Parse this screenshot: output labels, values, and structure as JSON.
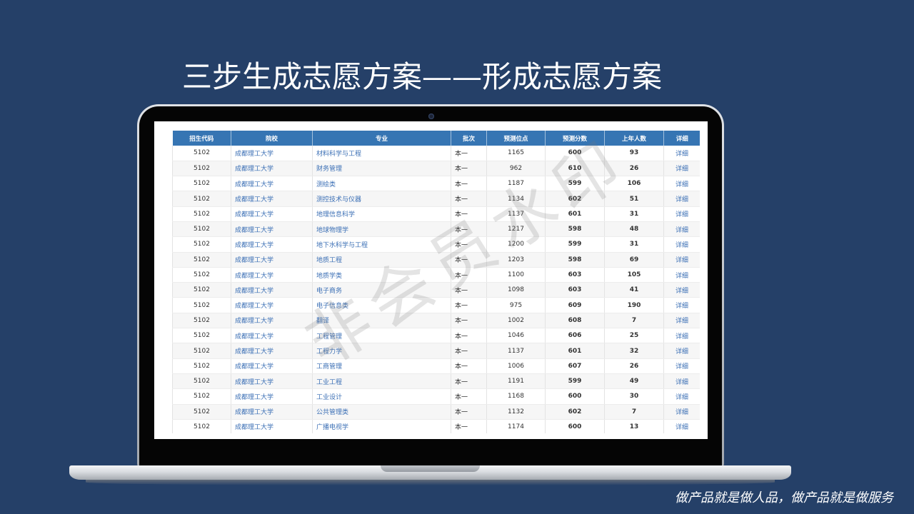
{
  "slide": {
    "title": "三步生成志愿方案——形成志愿方案",
    "footer_slogan": "做产品就是做人品，做产品就是做服务",
    "watermark": "非会员水印"
  },
  "colors": {
    "background": "#254068",
    "table_header": "#3675b3",
    "link": "#3b6fb5"
  },
  "table": {
    "headers": [
      "招生代码",
      "院校",
      "专业",
      "批次",
      "预测位点",
      "预测分数",
      "上年人数",
      "详细"
    ],
    "rows": [
      {
        "code": "5102",
        "school": "成都理工大学",
        "major": "材料科学与工程",
        "batch": "本一",
        "predicted_rank": 1165,
        "predicted_score": 600,
        "last_year_count": 93,
        "detail": "详细"
      },
      {
        "code": "5102",
        "school": "成都理工大学",
        "major": "财务管理",
        "batch": "本一",
        "predicted_rank": 962,
        "predicted_score": 610,
        "last_year_count": 26,
        "detail": "详细"
      },
      {
        "code": "5102",
        "school": "成都理工大学",
        "major": "测绘类",
        "batch": "本一",
        "predicted_rank": 1187,
        "predicted_score": 599,
        "last_year_count": 106,
        "detail": "详细"
      },
      {
        "code": "5102",
        "school": "成都理工大学",
        "major": "测控技术与仪器",
        "batch": "本一",
        "predicted_rank": 1134,
        "predicted_score": 602,
        "last_year_count": 51,
        "detail": "详细"
      },
      {
        "code": "5102",
        "school": "成都理工大学",
        "major": "地理信息科学",
        "batch": "本一",
        "predicted_rank": 1137,
        "predicted_score": 601,
        "last_year_count": 31,
        "detail": "详细"
      },
      {
        "code": "5102",
        "school": "成都理工大学",
        "major": "地球物理学",
        "batch": "本一",
        "predicted_rank": 1217,
        "predicted_score": 598,
        "last_year_count": 48,
        "detail": "详细"
      },
      {
        "code": "5102",
        "school": "成都理工大学",
        "major": "地下水科学与工程",
        "batch": "本一",
        "predicted_rank": 1200,
        "predicted_score": 599,
        "last_year_count": 31,
        "detail": "详细"
      },
      {
        "code": "5102",
        "school": "成都理工大学",
        "major": "地质工程",
        "batch": "本一",
        "predicted_rank": 1203,
        "predicted_score": 598,
        "last_year_count": 69,
        "detail": "详细"
      },
      {
        "code": "5102",
        "school": "成都理工大学",
        "major": "地质学类",
        "batch": "本一",
        "predicted_rank": 1100,
        "predicted_score": 603,
        "last_year_count": 105,
        "detail": "详细"
      },
      {
        "code": "5102",
        "school": "成都理工大学",
        "major": "电子商务",
        "batch": "本一",
        "predicted_rank": 1098,
        "predicted_score": 603,
        "last_year_count": 41,
        "detail": "详细"
      },
      {
        "code": "5102",
        "school": "成都理工大学",
        "major": "电子信息类",
        "batch": "本一",
        "predicted_rank": 975,
        "predicted_score": 609,
        "last_year_count": 190,
        "detail": "详细"
      },
      {
        "code": "5102",
        "school": "成都理工大学",
        "major": "翻译",
        "batch": "本一",
        "predicted_rank": 1002,
        "predicted_score": 608,
        "last_year_count": 7,
        "detail": "详细"
      },
      {
        "code": "5102",
        "school": "成都理工大学",
        "major": "工程管理",
        "batch": "本一",
        "predicted_rank": 1046,
        "predicted_score": 606,
        "last_year_count": 25,
        "detail": "详细"
      },
      {
        "code": "5102",
        "school": "成都理工大学",
        "major": "工程力学",
        "batch": "本一",
        "predicted_rank": 1137,
        "predicted_score": 601,
        "last_year_count": 32,
        "detail": "详细"
      },
      {
        "code": "5102",
        "school": "成都理工大学",
        "major": "工商管理",
        "batch": "本一",
        "predicted_rank": 1006,
        "predicted_score": 607,
        "last_year_count": 26,
        "detail": "详细"
      },
      {
        "code": "5102",
        "school": "成都理工大学",
        "major": "工业工程",
        "batch": "本一",
        "predicted_rank": 1191,
        "predicted_score": 599,
        "last_year_count": 49,
        "detail": "详细"
      },
      {
        "code": "5102",
        "school": "成都理工大学",
        "major": "工业设计",
        "batch": "本一",
        "predicted_rank": 1168,
        "predicted_score": 600,
        "last_year_count": 30,
        "detail": "详细"
      },
      {
        "code": "5102",
        "school": "成都理工大学",
        "major": "公共管理类",
        "batch": "本一",
        "predicted_rank": 1132,
        "predicted_score": 602,
        "last_year_count": 7,
        "detail": "详细"
      },
      {
        "code": "5102",
        "school": "成都理工大学",
        "major": "广播电视学",
        "batch": "本一",
        "predicted_rank": 1174,
        "predicted_score": 600,
        "last_year_count": 13,
        "detail": "详细"
      }
    ]
  }
}
